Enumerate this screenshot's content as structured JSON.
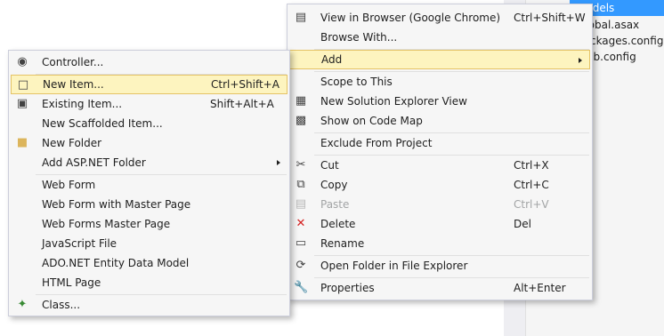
{
  "solution_explorer": {
    "items": [
      {
        "label": "Models",
        "selected": true
      },
      {
        "label": "Global.asax"
      },
      {
        "label": "packages.config"
      },
      {
        "label": "Web.config"
      }
    ]
  },
  "primary_menu": {
    "items": [
      {
        "label": "View in Browser (Google Chrome)",
        "shortcut": "Ctrl+Shift+W",
        "icon": "browser-icon"
      },
      {
        "label": "Browse With...",
        "shortcut": ""
      },
      {
        "label": "Add",
        "shortcut": "",
        "submenu": true,
        "highlighted": true
      },
      {
        "label": "Scope to This",
        "shortcut": ""
      },
      {
        "label": "New Solution Explorer View",
        "shortcut": "",
        "icon": "new-view-icon"
      },
      {
        "label": "Show on Code Map",
        "shortcut": "",
        "icon": "code-map-icon"
      },
      {
        "label": "Exclude From Project",
        "shortcut": ""
      },
      {
        "label": "Cut",
        "shortcut": "Ctrl+X",
        "icon": "scissors-icon"
      },
      {
        "label": "Copy",
        "shortcut": "Ctrl+C",
        "icon": "copy-icon"
      },
      {
        "label": "Paste",
        "shortcut": "Ctrl+V",
        "icon": "paste-icon",
        "disabled": true
      },
      {
        "label": "Delete",
        "shortcut": "Del",
        "icon": "delete-icon"
      },
      {
        "label": "Rename",
        "shortcut": "",
        "icon": "rename-icon"
      },
      {
        "label": "Open Folder in File Explorer",
        "shortcut": "",
        "icon": "refresh-folder-icon"
      },
      {
        "label": "Properties",
        "shortcut": "Alt+Enter",
        "icon": "wrench-icon"
      }
    ]
  },
  "add_submenu": {
    "items": [
      {
        "label": "Controller...",
        "shortcut": "",
        "icon": "controller-icon"
      },
      {
        "label": "New Item...",
        "shortcut": "Ctrl+Shift+A",
        "icon": "new-item-icon",
        "highlighted": true
      },
      {
        "label": "Existing Item...",
        "shortcut": "Shift+Alt+A",
        "icon": "existing-item-icon"
      },
      {
        "label": "New Scaffolded Item...",
        "shortcut": ""
      },
      {
        "label": "New Folder",
        "shortcut": "",
        "icon": "folder-icon"
      },
      {
        "label": "Add ASP.NET Folder",
        "shortcut": "",
        "submenu": true
      },
      {
        "label": "Web Form",
        "shortcut": ""
      },
      {
        "label": "Web Form with Master Page",
        "shortcut": ""
      },
      {
        "label": "Web Forms Master Page",
        "shortcut": ""
      },
      {
        "label": "JavaScript File",
        "shortcut": ""
      },
      {
        "label": "ADO.NET Entity Data Model",
        "shortcut": ""
      },
      {
        "label": "HTML Page",
        "shortcut": ""
      },
      {
        "label": "Class...",
        "shortcut": "",
        "icon": "class-icon"
      }
    ]
  },
  "colors": {
    "menu_bg": "#f6f6f6",
    "highlight_bg": "#fdf4bf",
    "highlight_border": "#e5c365",
    "selection_blue": "#3399ff",
    "disabled_text": "#a2a4a5"
  }
}
